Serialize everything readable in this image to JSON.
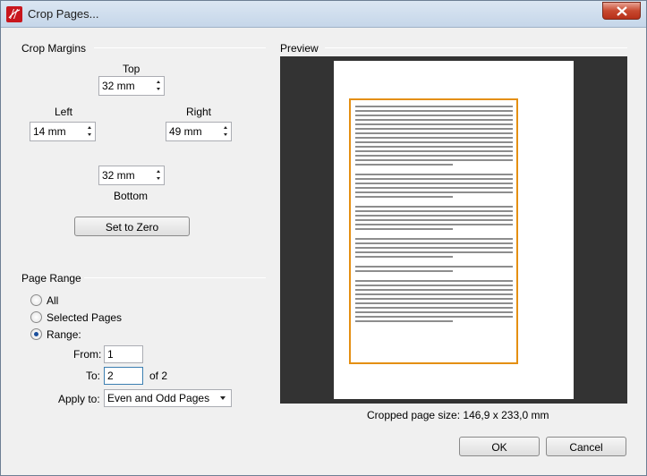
{
  "window": {
    "title": "Crop Pages..."
  },
  "crop_margins": {
    "title": "Crop Margins",
    "top_label": "Top",
    "top_value": "32 mm",
    "left_label": "Left",
    "left_value": "14 mm",
    "right_label": "Right",
    "right_value": "49 mm",
    "bottom_label": "Bottom",
    "bottom_value": "32 mm",
    "set_zero_label": "Set to Zero"
  },
  "page_range": {
    "title": "Page Range",
    "all_label": "All",
    "selected_label": "Selected Pages",
    "range_label": "Range:",
    "selected_option": "Range:",
    "from_label": "From:",
    "from_value": "1",
    "to_label": "To:",
    "to_value": "2",
    "of_label": "of 2",
    "apply_label": "Apply to:",
    "apply_value": "Even and Odd Pages"
  },
  "preview": {
    "title": "Preview",
    "cropped_size": "Cropped page size: 146,9 x 233,0 mm"
  },
  "buttons": {
    "ok": "OK",
    "cancel": "Cancel"
  },
  "colors": {
    "accent": "#e48f12",
    "preview_bg": "#333333",
    "app_icon": "#c8161d"
  }
}
